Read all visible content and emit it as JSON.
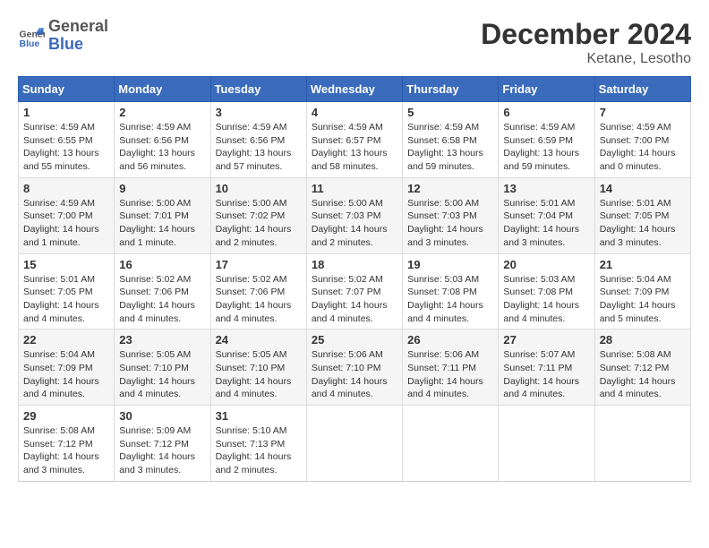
{
  "header": {
    "logo_line1": "General",
    "logo_line2": "Blue",
    "month": "December 2024",
    "location": "Ketane, Lesotho"
  },
  "days_of_week": [
    "Sunday",
    "Monday",
    "Tuesday",
    "Wednesday",
    "Thursday",
    "Friday",
    "Saturday"
  ],
  "weeks": [
    [
      {
        "day": "1",
        "rise": "4:59 AM",
        "set": "6:55 PM",
        "daylight": "13 hours and 55 minutes."
      },
      {
        "day": "2",
        "rise": "4:59 AM",
        "set": "6:56 PM",
        "daylight": "13 hours and 56 minutes."
      },
      {
        "day": "3",
        "rise": "4:59 AM",
        "set": "6:56 PM",
        "daylight": "13 hours and 57 minutes."
      },
      {
        "day": "4",
        "rise": "4:59 AM",
        "set": "6:57 PM",
        "daylight": "13 hours and 58 minutes."
      },
      {
        "day": "5",
        "rise": "4:59 AM",
        "set": "6:58 PM",
        "daylight": "13 hours and 59 minutes."
      },
      {
        "day": "6",
        "rise": "4:59 AM",
        "set": "6:59 PM",
        "daylight": "13 hours and 59 minutes."
      },
      {
        "day": "7",
        "rise": "4:59 AM",
        "set": "7:00 PM",
        "daylight": "14 hours and 0 minutes."
      }
    ],
    [
      {
        "day": "8",
        "rise": "4:59 AM",
        "set": "7:00 PM",
        "daylight": "14 hours and 1 minute."
      },
      {
        "day": "9",
        "rise": "5:00 AM",
        "set": "7:01 PM",
        "daylight": "14 hours and 1 minute."
      },
      {
        "day": "10",
        "rise": "5:00 AM",
        "set": "7:02 PM",
        "daylight": "14 hours and 2 minutes."
      },
      {
        "day": "11",
        "rise": "5:00 AM",
        "set": "7:03 PM",
        "daylight": "14 hours and 2 minutes."
      },
      {
        "day": "12",
        "rise": "5:00 AM",
        "set": "7:03 PM",
        "daylight": "14 hours and 3 minutes."
      },
      {
        "day": "13",
        "rise": "5:01 AM",
        "set": "7:04 PM",
        "daylight": "14 hours and 3 minutes."
      },
      {
        "day": "14",
        "rise": "5:01 AM",
        "set": "7:05 PM",
        "daylight": "14 hours and 3 minutes."
      }
    ],
    [
      {
        "day": "15",
        "rise": "5:01 AM",
        "set": "7:05 PM",
        "daylight": "14 hours and 4 minutes."
      },
      {
        "day": "16",
        "rise": "5:02 AM",
        "set": "7:06 PM",
        "daylight": "14 hours and 4 minutes."
      },
      {
        "day": "17",
        "rise": "5:02 AM",
        "set": "7:06 PM",
        "daylight": "14 hours and 4 minutes."
      },
      {
        "day": "18",
        "rise": "5:02 AM",
        "set": "7:07 PM",
        "daylight": "14 hours and 4 minutes."
      },
      {
        "day": "19",
        "rise": "5:03 AM",
        "set": "7:08 PM",
        "daylight": "14 hours and 4 minutes."
      },
      {
        "day": "20",
        "rise": "5:03 AM",
        "set": "7:08 PM",
        "daylight": "14 hours and 4 minutes."
      },
      {
        "day": "21",
        "rise": "5:04 AM",
        "set": "7:09 PM",
        "daylight": "14 hours and 5 minutes."
      }
    ],
    [
      {
        "day": "22",
        "rise": "5:04 AM",
        "set": "7:09 PM",
        "daylight": "14 hours and 4 minutes."
      },
      {
        "day": "23",
        "rise": "5:05 AM",
        "set": "7:10 PM",
        "daylight": "14 hours and 4 minutes."
      },
      {
        "day": "24",
        "rise": "5:05 AM",
        "set": "7:10 PM",
        "daylight": "14 hours and 4 minutes."
      },
      {
        "day": "25",
        "rise": "5:06 AM",
        "set": "7:10 PM",
        "daylight": "14 hours and 4 minutes."
      },
      {
        "day": "26",
        "rise": "5:06 AM",
        "set": "7:11 PM",
        "daylight": "14 hours and 4 minutes."
      },
      {
        "day": "27",
        "rise": "5:07 AM",
        "set": "7:11 PM",
        "daylight": "14 hours and 4 minutes."
      },
      {
        "day": "28",
        "rise": "5:08 AM",
        "set": "7:12 PM",
        "daylight": "14 hours and 4 minutes."
      }
    ],
    [
      {
        "day": "29",
        "rise": "5:08 AM",
        "set": "7:12 PM",
        "daylight": "14 hours and 3 minutes."
      },
      {
        "day": "30",
        "rise": "5:09 AM",
        "set": "7:12 PM",
        "daylight": "14 hours and 3 minutes."
      },
      {
        "day": "31",
        "rise": "5:10 AM",
        "set": "7:13 PM",
        "daylight": "14 hours and 2 minutes."
      },
      null,
      null,
      null,
      null
    ]
  ],
  "labels": {
    "sunrise": "Sunrise:",
    "sunset": "Sunset:",
    "daylight": "Daylight:"
  }
}
